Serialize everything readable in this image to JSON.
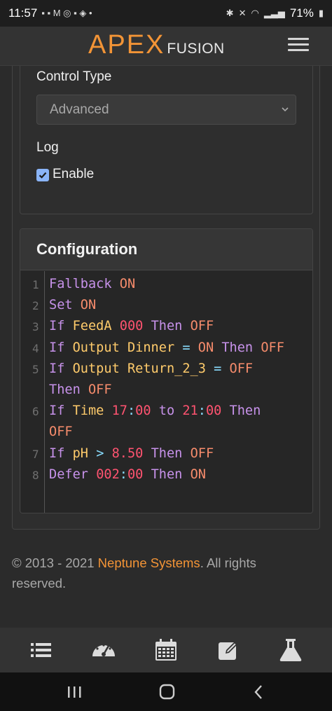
{
  "status_bar": {
    "time": "11:57",
    "battery": "71%"
  },
  "header": {
    "logo_main": "APEX",
    "logo_sub": "FUSION"
  },
  "form": {
    "control_type_label": "Control Type",
    "control_type_value": "Advanced",
    "log_label": "Log",
    "enable_label": "Enable",
    "enable_checked": true
  },
  "config": {
    "title": "Configuration",
    "lines": [
      {
        "n": "1",
        "tokens": [
          {
            "t": "Fallback",
            "c": "kw"
          },
          {
            "t": " ",
            "c": ""
          },
          {
            "t": "ON",
            "c": "on"
          }
        ]
      },
      {
        "n": "2",
        "tokens": [
          {
            "t": "Set",
            "c": "kw"
          },
          {
            "t": " ",
            "c": ""
          },
          {
            "t": "ON",
            "c": "on"
          }
        ]
      },
      {
        "n": "3",
        "tokens": [
          {
            "t": "If",
            "c": "kw"
          },
          {
            "t": " ",
            "c": ""
          },
          {
            "t": "FeedA",
            "c": "var"
          },
          {
            "t": " ",
            "c": ""
          },
          {
            "t": "000",
            "c": "num"
          },
          {
            "t": " ",
            "c": ""
          },
          {
            "t": "Then",
            "c": "kw"
          },
          {
            "t": " ",
            "c": ""
          },
          {
            "t": "OFF",
            "c": "on"
          }
        ]
      },
      {
        "n": "4",
        "tokens": [
          {
            "t": "If",
            "c": "kw"
          },
          {
            "t": " ",
            "c": ""
          },
          {
            "t": "Output",
            "c": "var"
          },
          {
            "t": " ",
            "c": ""
          },
          {
            "t": "Dinner",
            "c": "var"
          },
          {
            "t": " ",
            "c": ""
          },
          {
            "t": "=",
            "c": "op"
          },
          {
            "t": " ",
            "c": ""
          },
          {
            "t": "ON",
            "c": "on"
          },
          {
            "t": " ",
            "c": ""
          },
          {
            "t": "Then",
            "c": "kw"
          },
          {
            "t": " ",
            "c": ""
          },
          {
            "t": "OFF",
            "c": "on"
          }
        ]
      },
      {
        "n": "5",
        "tokens": [
          {
            "t": "If",
            "c": "kw"
          },
          {
            "t": " ",
            "c": ""
          },
          {
            "t": "Output",
            "c": "var"
          },
          {
            "t": " ",
            "c": ""
          },
          {
            "t": "Return_2_3",
            "c": "var"
          },
          {
            "t": " ",
            "c": ""
          },
          {
            "t": "=",
            "c": "op"
          },
          {
            "t": " ",
            "c": ""
          },
          {
            "t": "OFF",
            "c": "on"
          }
        ],
        "wrap": [
          {
            "t": "Then",
            "c": "kw"
          },
          {
            "t": " ",
            "c": ""
          },
          {
            "t": "OFF",
            "c": "on"
          }
        ]
      },
      {
        "n": "6",
        "tokens": [
          {
            "t": "If",
            "c": "kw"
          },
          {
            "t": " ",
            "c": ""
          },
          {
            "t": "Time",
            "c": "var"
          },
          {
            "t": " ",
            "c": ""
          },
          {
            "t": "17",
            "c": "num"
          },
          {
            "t": ":",
            "c": "op"
          },
          {
            "t": "00",
            "c": "num"
          },
          {
            "t": " ",
            "c": ""
          },
          {
            "t": "to",
            "c": "kw"
          },
          {
            "t": " ",
            "c": ""
          },
          {
            "t": "21",
            "c": "num"
          },
          {
            "t": ":",
            "c": "op"
          },
          {
            "t": "00",
            "c": "num"
          },
          {
            "t": " ",
            "c": ""
          },
          {
            "t": "Then",
            "c": "kw"
          }
        ],
        "wrap": [
          {
            "t": "OFF",
            "c": "on"
          }
        ]
      },
      {
        "n": "7",
        "tokens": [
          {
            "t": "If",
            "c": "kw"
          },
          {
            "t": " ",
            "c": ""
          },
          {
            "t": "pH",
            "c": "var"
          },
          {
            "t": " ",
            "c": ""
          },
          {
            "t": ">",
            "c": "op"
          },
          {
            "t": " ",
            "c": ""
          },
          {
            "t": "8.50",
            "c": "num"
          },
          {
            "t": " ",
            "c": ""
          },
          {
            "t": "Then",
            "c": "kw"
          },
          {
            "t": " ",
            "c": ""
          },
          {
            "t": "OFF",
            "c": "on"
          }
        ]
      },
      {
        "n": "8",
        "tokens": [
          {
            "t": "Defer",
            "c": "kw"
          },
          {
            "t": " ",
            "c": ""
          },
          {
            "t": "002",
            "c": "num"
          },
          {
            "t": ":",
            "c": "op"
          },
          {
            "t": "00",
            "c": "num"
          },
          {
            "t": " ",
            "c": ""
          },
          {
            "t": "Then",
            "c": "kw"
          },
          {
            "t": " ",
            "c": ""
          },
          {
            "t": "ON",
            "c": "on"
          }
        ]
      }
    ]
  },
  "footer": {
    "copyright_prefix": "© 2013 - 2021 ",
    "company": "Neptune Systems",
    "copyright_suffix": ". All rights reserved."
  },
  "bottom_nav": {
    "icons": [
      "list-icon",
      "dashboard-gauge-icon",
      "calendar-icon",
      "edit-icon",
      "flask-icon"
    ]
  },
  "colors": {
    "accent": "#f39436",
    "keyword": "#c792ea",
    "state": "#f78c6c",
    "variable": "#ffcb6b",
    "number": "#ff5370",
    "operator": "#89ddff"
  }
}
